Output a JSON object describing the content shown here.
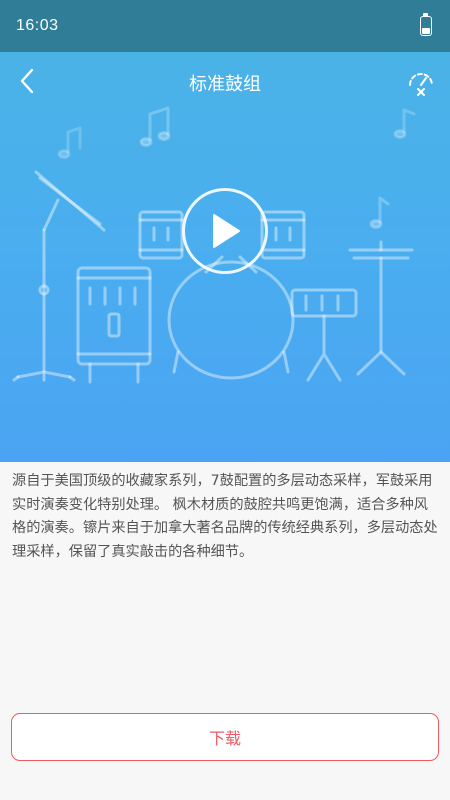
{
  "status_bar": {
    "time": "16:03",
    "battery_icon": "battery-icon"
  },
  "header": {
    "title": "标准鼓组",
    "back_icon": "chevron-left-icon",
    "right_icon": "gauge-icon"
  },
  "hero": {
    "illustration": "drum-kit-illustration",
    "play_icon": "play-icon",
    "background_colors": [
      "#4ab3e6",
      "#4ba4f3"
    ]
  },
  "description": "源自于美国顶级的收藏家系列，7鼓配置的多层动态采样，军鼓采用实时演奏变化特别处理。 枫木材质的鼓腔共鸣更饱满，适合多种风格的演奏。镲片来自于加拿大著名品牌的传统经典系列，多层动态处理采样，保留了真实敲击的各种细节。",
  "download": {
    "label": "下载",
    "accent_color": "#ee5b64"
  }
}
